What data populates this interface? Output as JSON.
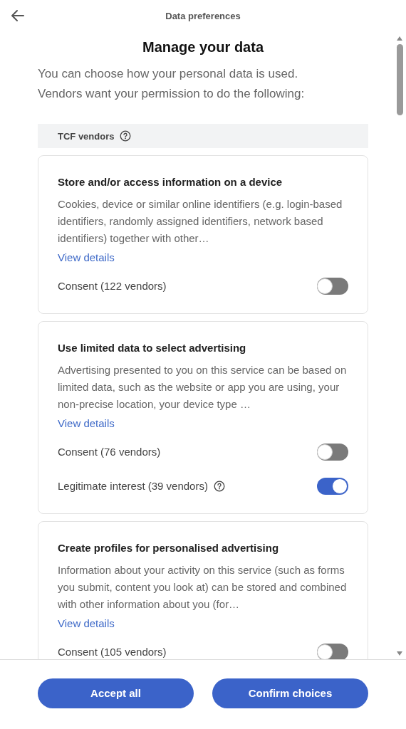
{
  "header": {
    "title": "Data preferences"
  },
  "heading": "Manage your data",
  "intro": "You can choose how your personal data is used. Vendors want your permission to do the following:",
  "section": {
    "label": "TCF vendors",
    "info": true
  },
  "purposes": [
    {
      "title": "Store and/or access information on a device",
      "description": "Cookies, device or similar online identifiers (e.g. login-based identifiers, randomly assigned identifiers, network based identifiers) together with other…",
      "link": "View details",
      "options": [
        {
          "label": "Consent (122 vendors)",
          "info": false,
          "on": false
        }
      ]
    },
    {
      "title": "Use limited data to select advertising",
      "description": "Advertising presented to you on this service can be based on limited data, such as the website or app you are using, your non-precise location, your device type …",
      "link": "View details",
      "options": [
        {
          "label": "Consent (76 vendors)",
          "info": false,
          "on": false
        },
        {
          "label": "Legitimate interest (39 vendors)",
          "info": true,
          "on": true
        }
      ]
    },
    {
      "title": "Create profiles for personalised advertising",
      "description": "Information about your activity on this service (such as forms you submit, content you look at) can be stored and combined with other information about you (for…",
      "link": "View details",
      "options": [
        {
          "label": "Consent (105 vendors)",
          "info": false,
          "on": false
        }
      ]
    }
  ],
  "buttons": [
    "Accept all",
    "Confirm choices"
  ]
}
